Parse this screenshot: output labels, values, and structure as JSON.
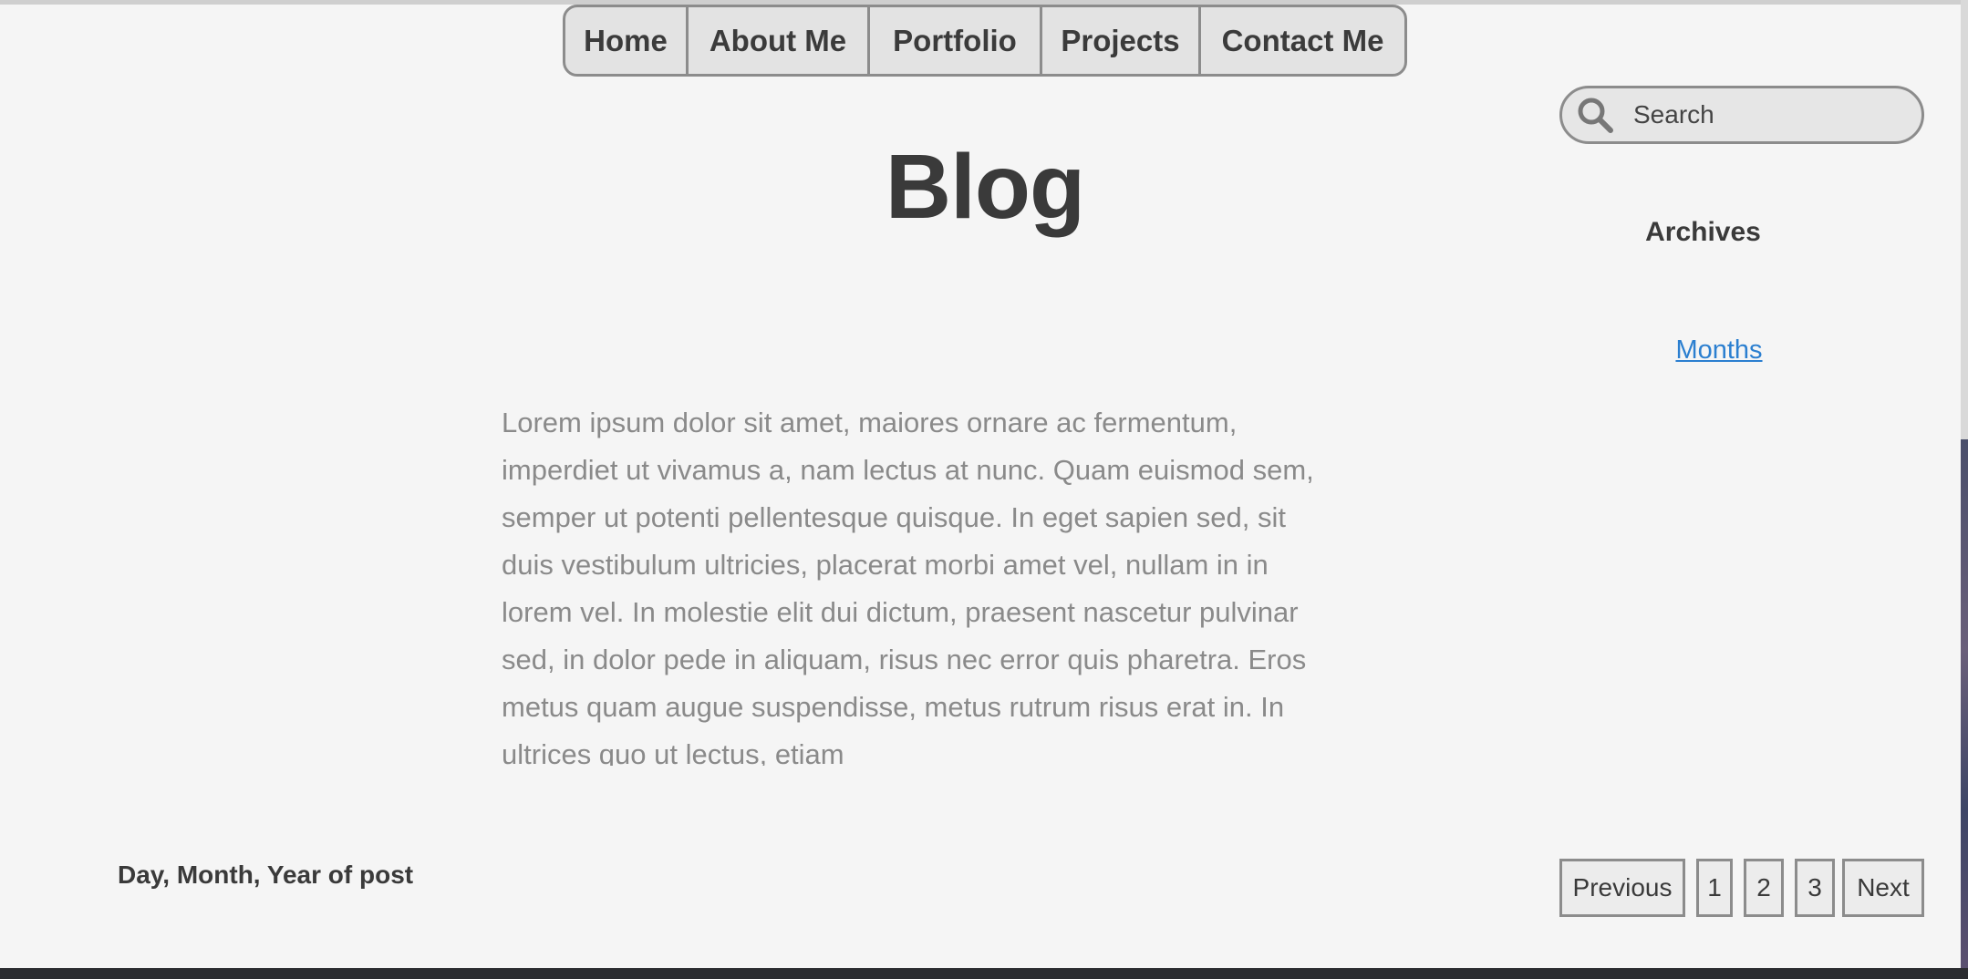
{
  "nav": {
    "items": [
      {
        "label": "Home"
      },
      {
        "label": "About Me"
      },
      {
        "label": "Portfolio"
      },
      {
        "label": "Projects"
      },
      {
        "label": "Contact Me"
      }
    ]
  },
  "search": {
    "placeholder": "Search"
  },
  "page": {
    "title": "Blog"
  },
  "sidebar": {
    "archives_heading": "Archives",
    "months_link": "Months"
  },
  "post": {
    "body": "Lorem ipsum dolor sit amet, maiores ornare ac fermentum, imperdiet ut vivamus a, nam lectus at nunc. Quam euismod sem, semper ut potenti pellentesque quisque. In eget sapien sed, sit duis vestibulum ultricies, placerat morbi amet vel, nullam in in lorem vel. In molestie elit dui dictum, praesent nascetur pulvinar sed, in dolor pede in aliquam, risus nec error quis pharetra. Eros metus quam augue suspendisse, metus rutrum risus erat in.  In ultrices quo ut lectus, etiam",
    "date_label": "Day, Month, Year of post"
  },
  "pagination": {
    "previous": "Previous",
    "pages": [
      "1",
      "2",
      "3"
    ],
    "next": "Next"
  },
  "colors": {
    "background": "#f5f5f5",
    "nav_bg": "#e3e3e3",
    "border": "#8c8c8c",
    "link": "#2b7fd0",
    "body_text": "#8a8a8a"
  }
}
